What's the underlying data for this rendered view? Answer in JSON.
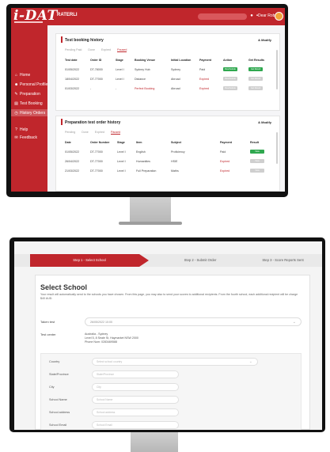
{
  "brand": {
    "logo": "i-DAT",
    "accent": "#c0262c"
  },
  "top_bar": {
    "title": "RATERLI",
    "user": "Dear Robert"
  },
  "sidebar": {
    "items": [
      {
        "label": "Home",
        "icon": "home-icon"
      },
      {
        "label": "Personal Profile",
        "icon": "profile-icon"
      },
      {
        "label": "Preparation",
        "icon": "preparation-icon"
      },
      {
        "label": "Test Booking",
        "icon": "booking-icon"
      },
      {
        "label": "History Orders",
        "icon": "history-icon"
      },
      {
        "label": "Help",
        "icon": "help-icon"
      },
      {
        "label": "Feedback",
        "icon": "feedback-icon"
      }
    ]
  },
  "booking_panel": {
    "title": "Test booking history",
    "action": "& Modify",
    "tabs": [
      "Pending Paid",
      "Done",
      "Expired",
      "Paused"
    ],
    "columns": [
      "Test date",
      "Order ID",
      "Stage",
      "Booking Venue",
      "Initial Location",
      "Payment",
      "Action",
      "Get Results"
    ],
    "rows": [
      {
        "date": "01/05/2022",
        "order": "DT-78000",
        "stage": "Level I",
        "venue": "Sydney Hub",
        "location": "Sydney",
        "payment": "Paid",
        "action": "Reschedule",
        "result": "Get Result"
      },
      {
        "date": "18/04/2022",
        "order": "DT-77000",
        "stage": "Level I",
        "venue": "Distance",
        "location": "Abroad",
        "payment": "Expired",
        "action": "Reschedule",
        "result": "Get Result"
      },
      {
        "date": "01/03/2022",
        "order": "-",
        "stage": "-",
        "venue": "Perfect Booking",
        "location": "Abroad",
        "payment": "Expired",
        "action": "Reschedule",
        "result": "Get Result"
      }
    ]
  },
  "prep_panel": {
    "title": "Preparation test order history",
    "action": "& Modify",
    "tabs": [
      "Pending",
      "Done",
      "Expired",
      "Paused"
    ],
    "columns": [
      "Date",
      "Order Number",
      "Stage",
      "Item",
      "Subject",
      "Payment",
      "Result"
    ],
    "rows": [
      {
        "date": "01/05/2022",
        "order": "DT-77000",
        "stage": "Level I",
        "item": "Engilsh",
        "subject": "Proficiency",
        "payment": "Paid",
        "result": "View"
      },
      {
        "date": "26/04/2022",
        "order": "DT-77000",
        "stage": "Level I",
        "item": "Humanities",
        "subject": "HSIE",
        "payment": "Expired",
        "result": "View"
      },
      {
        "date": "21/03/2022",
        "order": "DT-77000",
        "stage": "Level I",
        "item": "Full Preparation",
        "subject": "Maths",
        "payment": "Expired",
        "result": "View"
      }
    ]
  },
  "wizard": {
    "steps": [
      "Step 1 - Select School",
      "Step 2 - Submit Order",
      "Step 3 - Score Reports Sent"
    ],
    "title": "Select School",
    "description": "Your result will automatically send to the schools you have chosen. From this page, you may also to send your scores to additional recipients. From the fourth school, each additional recipient will be charge $40 AUD.",
    "taken_test_label": "Taken test",
    "taken_test_value": "26/05/2022 10:00",
    "test_center_label": "Test center",
    "test_center_lines": [
      "Australia - Sydney",
      "Level 5, 8 Seale St, Haymarket NSW 2000",
      "Phone Num: 0283469588"
    ],
    "form": [
      {
        "label": "Country",
        "placeholder": "Select school country"
      },
      {
        "label": "State/Province",
        "placeholder": "State/Province"
      },
      {
        "label": "City",
        "placeholder": "City"
      },
      {
        "label": "School Name",
        "placeholder": "School Name"
      },
      {
        "label": "School address",
        "placeholder": "School address"
      },
      {
        "label": "School Email",
        "placeholder": "School Email"
      }
    ]
  }
}
